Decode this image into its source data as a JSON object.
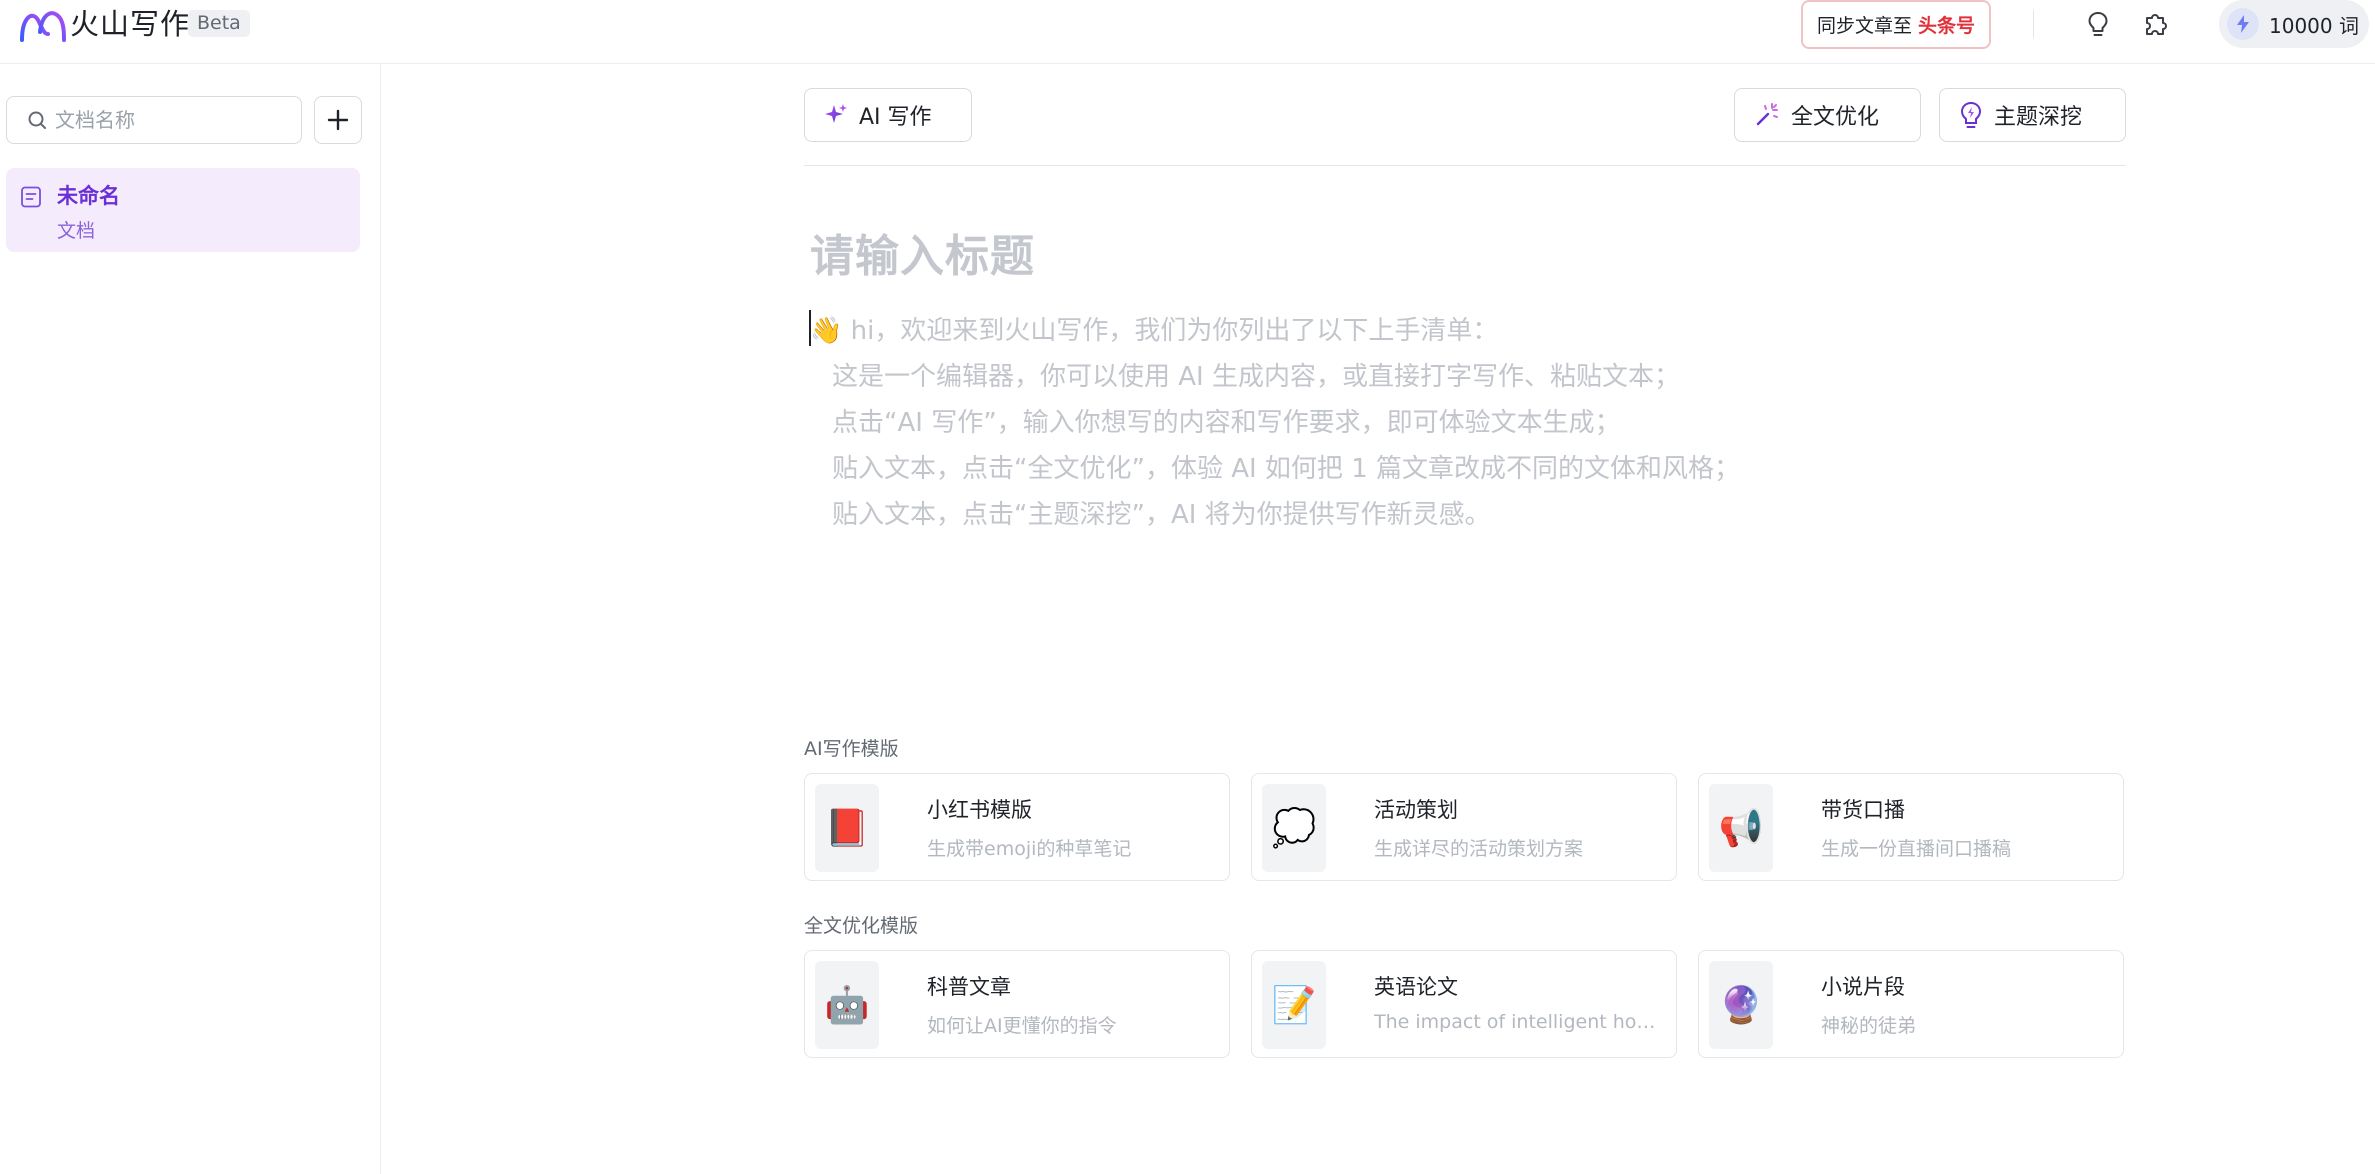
{
  "header": {
    "brand": "火山写作",
    "beta": "Beta",
    "sync_prefix": "同步文章至",
    "sync_target": "头条号",
    "credits": "10000 词"
  },
  "sidebar": {
    "search_placeholder": "文档名称",
    "docs": [
      {
        "title": "未命名",
        "subtitle": "文档"
      }
    ]
  },
  "toolbar": {
    "ai_write": "AI 写作",
    "optimize": "全文优化",
    "deep_dive": "主题深挖"
  },
  "editor": {
    "title_placeholder": "请输入标题",
    "intro": {
      "greeting_emoji": "👋",
      "greeting": " hi，欢迎来到火山写作，我们为你列出了以下上手清单：",
      "items": [
        "这是一个编辑器，你可以使用 AI 生成内容，或直接打字写作、粘贴文本；",
        "点击“AI 写作”，输入你想写的内容和写作要求，即可体验文本生成；",
        "贴入文本，点击“全文优化”，体验 AI 如何把 1 篇文章改成不同的文体和风格；",
        "贴入文本，点击“主题深挖”，AI 将为你提供写作新灵感。"
      ]
    }
  },
  "templates": {
    "ai_section_label": "AI写作模版",
    "ai": [
      {
        "emoji": "📕",
        "title": "小红书模版",
        "desc": "生成带emoji的种草笔记"
      },
      {
        "emoji": "💭",
        "title": "活动策划",
        "desc": "生成详尽的活动策划方案"
      },
      {
        "emoji": "📢",
        "title": "带货口播",
        "desc": "生成一份直播间口播稿"
      }
    ],
    "optimize_section_label": "全文优化模版",
    "optimize": [
      {
        "emoji": "🤖",
        "title": "科普文章",
        "desc": "如何让AI更懂你的指令"
      },
      {
        "emoji": "📝",
        "title": "英语论文",
        "desc": "The impact of intelligent household appliances"
      },
      {
        "emoji": "🔮",
        "title": "小说片段",
        "desc": "神秘的徒弟"
      }
    ]
  },
  "colors": {
    "accent": "#6b2fd6",
    "selected_bg": "#f4ecfd",
    "toutiao_red": "#e0323c"
  }
}
